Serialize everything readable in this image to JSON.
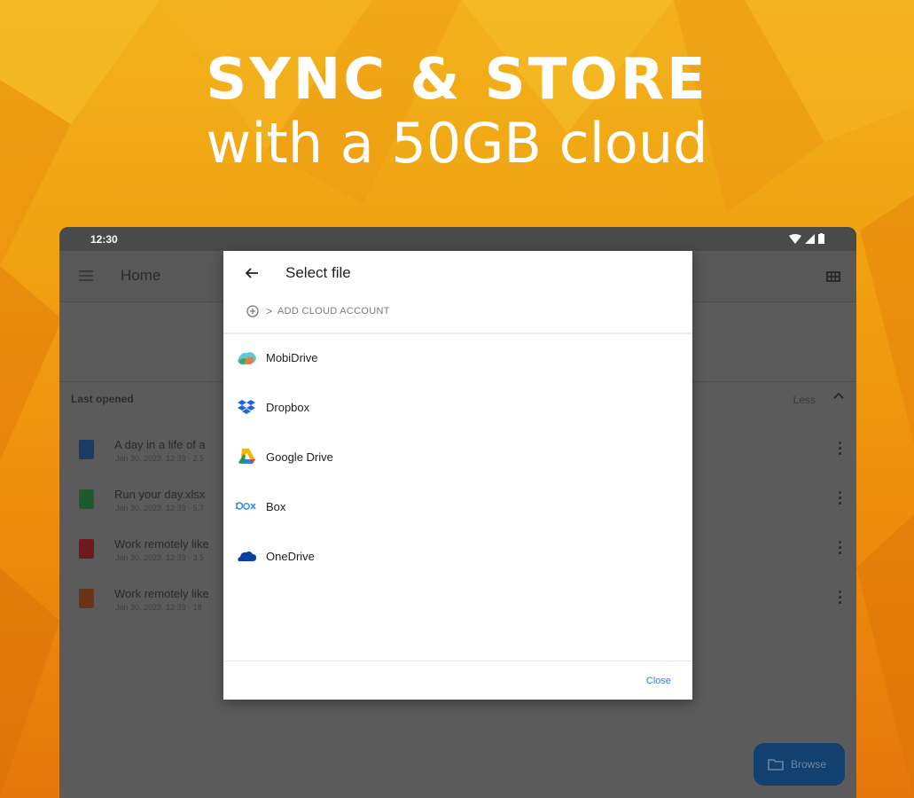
{
  "promo": {
    "headline": "SYNC & STORE",
    "subheadline": "with a 50GB cloud"
  },
  "status_bar": {
    "time": "12:30",
    "icons": [
      "wifi-icon",
      "signal-icon",
      "battery-icon"
    ]
  },
  "app_bar": {
    "title": "Home",
    "icons": [
      "menu-icon",
      "grid-view-icon"
    ]
  },
  "last_opened": {
    "heading": "Last opened",
    "toggle_label": "Less",
    "files": [
      {
        "name": "A day in a life of a",
        "meta": "Jan 30, 2023, 12:33 · 2.5",
        "icon": "doc-icon",
        "color": "#1c3a66"
      },
      {
        "name": "Run your day.xlsx",
        "meta": "Jan 30, 2023, 12:33 · 5.7",
        "icon": "sheet-icon",
        "color": "#1d5a2c"
      },
      {
        "name": "Work remotely like",
        "meta": "Jan 30, 2023, 12:33 · 3.5",
        "icon": "pdf-icon",
        "color": "#6e1a1a"
      },
      {
        "name": "Work remotely like",
        "meta": "Jan 30, 2023, 12:33 · 18",
        "icon": "ppt-icon",
        "color": "#6a3416"
      }
    ]
  },
  "fab": {
    "label": "Browse"
  },
  "dialog": {
    "title": "Select file",
    "add_account": "ADD CLOUD ACCOUNT",
    "providers": [
      {
        "name": "MobiDrive",
        "icon": "mobidrive-icon"
      },
      {
        "name": "Dropbox",
        "icon": "dropbox-icon"
      },
      {
        "name": "Google Drive",
        "icon": "google-drive-icon"
      },
      {
        "name": "Box",
        "icon": "box-icon"
      },
      {
        "name": "OneDrive",
        "icon": "onedrive-icon"
      }
    ],
    "close_label": "Close"
  },
  "colors": {
    "background": "#f0a010",
    "accent_link": "#2f7fd8",
    "fab": "#12406f"
  }
}
